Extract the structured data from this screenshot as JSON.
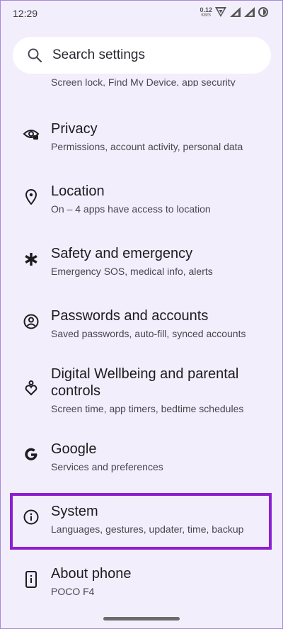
{
  "status_bar": {
    "time": "12:29",
    "net_speed_value": "0.12",
    "net_speed_unit": "KB/S"
  },
  "search": {
    "placeholder": "Search settings"
  },
  "clipped_item": {
    "subtitle": "Screen lock, Find My Device, app security"
  },
  "items": [
    {
      "title": "Privacy",
      "subtitle": "Permissions, account activity, personal data",
      "icon": "privacy-eye-icon"
    },
    {
      "title": "Location",
      "subtitle": "On – 4 apps have access to location",
      "icon": "location-pin-icon"
    },
    {
      "title": "Safety and emergency",
      "subtitle": "Emergency SOS, medical info, alerts",
      "icon": "asterisk-icon"
    },
    {
      "title": "Passwords and accounts",
      "subtitle": "Saved passwords, auto-fill, synced accounts",
      "icon": "account-circle-icon"
    },
    {
      "title": "Digital Wellbeing and parental controls",
      "subtitle": "Screen time, app timers, bedtime schedules",
      "icon": "wellbeing-icon"
    },
    {
      "title": "Google",
      "subtitle": "Services and preferences",
      "icon": "google-g-icon"
    },
    {
      "title": "System",
      "subtitle": "Languages, gestures, updater, time, backup",
      "icon": "info-circle-icon"
    },
    {
      "title": "About phone",
      "subtitle": "POCO F4",
      "icon": "phone-info-icon"
    }
  ],
  "colors": {
    "background": "#f3eefb",
    "highlight": "#8c1fd0"
  }
}
